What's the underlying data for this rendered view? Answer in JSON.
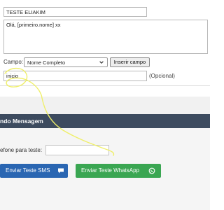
{
  "form": {
    "name_value": "TESTE ELIAKIM",
    "message_value": "Olá, [primeiro.nome] xx",
    "campo_label": "Campo:",
    "campo_select_value": "Nome Completo",
    "insert_field_label": "Inserir campo",
    "code_value": "inicio",
    "optional_label": "(Opcional)"
  },
  "sending": {
    "header_title": "ndo Mensagem",
    "phone_label": "efone para teste:",
    "phone_value": "",
    "sms_button_label": "Enviar Teste SMS",
    "whatsapp_button_label": "Enviar Teste WhatsApp"
  },
  "colors": {
    "header_bg": "#3d4b5f",
    "sms_button": "#2a66b2",
    "whatsapp_button": "#3aa652",
    "annotation_stroke": "#efef6a"
  },
  "icons": {
    "select_arrow": "chevron-down-icon",
    "sms": "chat-bubble-icon",
    "whatsapp": "whatsapp-icon"
  }
}
